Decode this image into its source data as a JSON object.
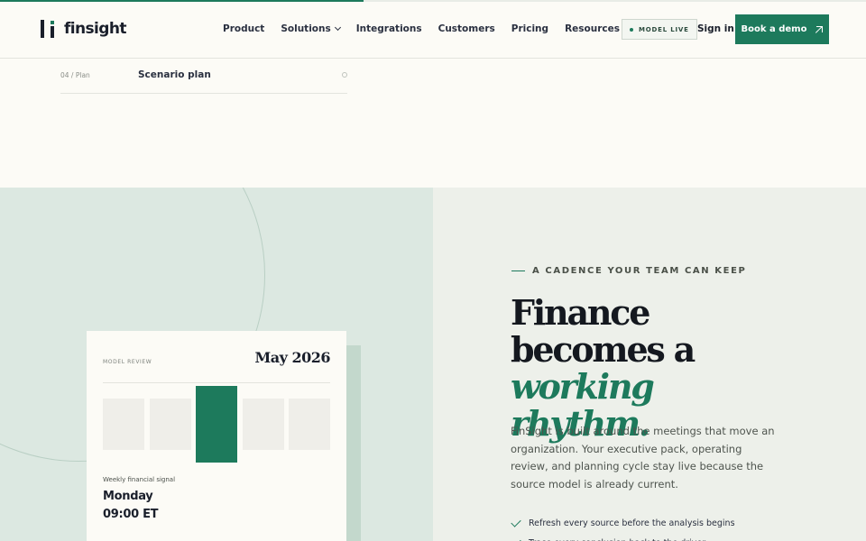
{
  "progress": {
    "fraction": 0.42,
    "color": "#1d7a5c"
  },
  "brand": {
    "name": "finsight",
    "accent": "#1d7a5c"
  },
  "nav": {
    "items": [
      {
        "label": "Product",
        "has_dropdown": false
      },
      {
        "label": "Solutions",
        "has_dropdown": true
      },
      {
        "label": "Integrations",
        "has_dropdown": false
      },
      {
        "label": "Customers",
        "has_dropdown": false
      },
      {
        "label": "Pricing",
        "has_dropdown": false
      },
      {
        "label": "Resources",
        "has_dropdown": false
      }
    ]
  },
  "header": {
    "status_badge": "MODEL LIVE",
    "sign_in": "Sign in",
    "cta": "Book a demo"
  },
  "plan_row": {
    "step": "04 / Plan",
    "title": "Scenario plan"
  },
  "review_card": {
    "label": "MODEL REVIEW",
    "date": "May 2026",
    "bars": [
      {
        "level": 0.68,
        "active": false
      },
      {
        "level": 0.68,
        "active": false
      },
      {
        "level": 1.0,
        "active": true
      },
      {
        "level": 0.68,
        "active": false
      },
      {
        "level": 0.68,
        "active": false
      }
    ],
    "signal_label": "Weekly financial signal",
    "signal_day": "Monday",
    "signal_time": "09:00 ET"
  },
  "cadence": {
    "eyebrow": "A CADENCE YOUR TEAM CAN KEEP",
    "headline_line1": "Finance becomes a",
    "headline_accent": "working rhythm.",
    "body": "FinSight is built around the meetings that move an organization. Your executive pack, operating review, and planning cycle stay live because the source model is already current.",
    "checklist": [
      "Refresh every source before the analysis begins",
      "Trace every conclusion back to the driver"
    ]
  }
}
